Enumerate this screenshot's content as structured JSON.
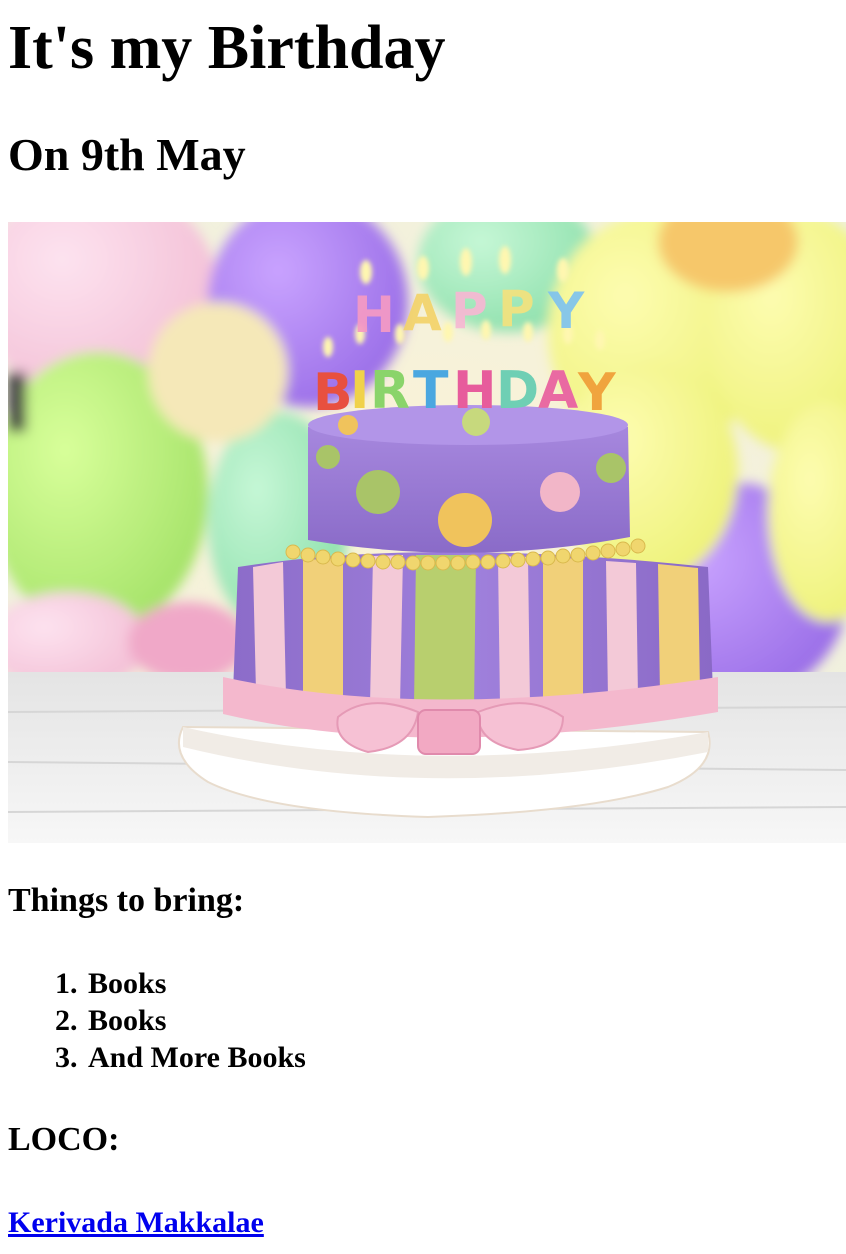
{
  "heading": "It's my Birthday",
  "date": "On 9th May",
  "image": {
    "subject": "birthday cake with HAPPY BIRTHDAY candles",
    "candle_top": "HAPPY",
    "candle_bottom": "BIRTHDAY"
  },
  "bring_heading": "Things to bring:",
  "bring_items": [
    {
      "num": "1.",
      "text": "Books"
    },
    {
      "num": "2.",
      "text": "Books"
    },
    {
      "num": "3.",
      "text": "And More Books"
    }
  ],
  "location_heading": "LOCO:",
  "location_link": "Kerivada Makkalae",
  "colors": {
    "link": "#0000ee",
    "text": "#000000",
    "background": "#ffffff"
  }
}
